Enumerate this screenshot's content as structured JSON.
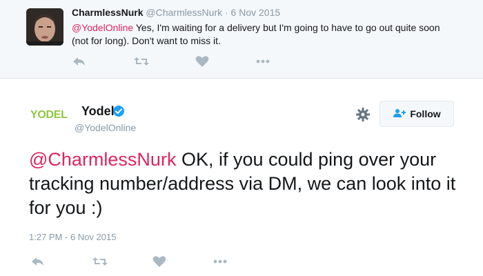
{
  "reply_tweet": {
    "author_name": "CharmlessNurk",
    "author_handle": "@CharmlessNurk",
    "separator": "·",
    "date": "6 Nov 2015",
    "mention": "@YodelOnline",
    "text": " Yes, I'm waiting for a delivery but I'm going to have to go out quite soon (not for long). Don't want to miss it."
  },
  "main_tweet": {
    "logo_text": "YODEL",
    "author_name": "Yodel",
    "author_handle": "@YodelOnline",
    "follow_label": "Follow",
    "mention": "@CharmlessNurk",
    "text": " OK, if you could ping over your tracking number/address via DM, we can look into it for you :)",
    "timestamp": "1:27 PM - 6 Nov 2015"
  },
  "icons": [
    "reply-icon",
    "retweet-icon",
    "like-icon",
    "more-icon",
    "verified-badge-icon",
    "gear-icon",
    "follow-user-icon"
  ],
  "colors": {
    "mention": "#e0245e",
    "muted": "#8899a6",
    "verified": "#1da1f2",
    "brand_green": "#8dc63f",
    "reply_bg": "#f5f8fa"
  }
}
